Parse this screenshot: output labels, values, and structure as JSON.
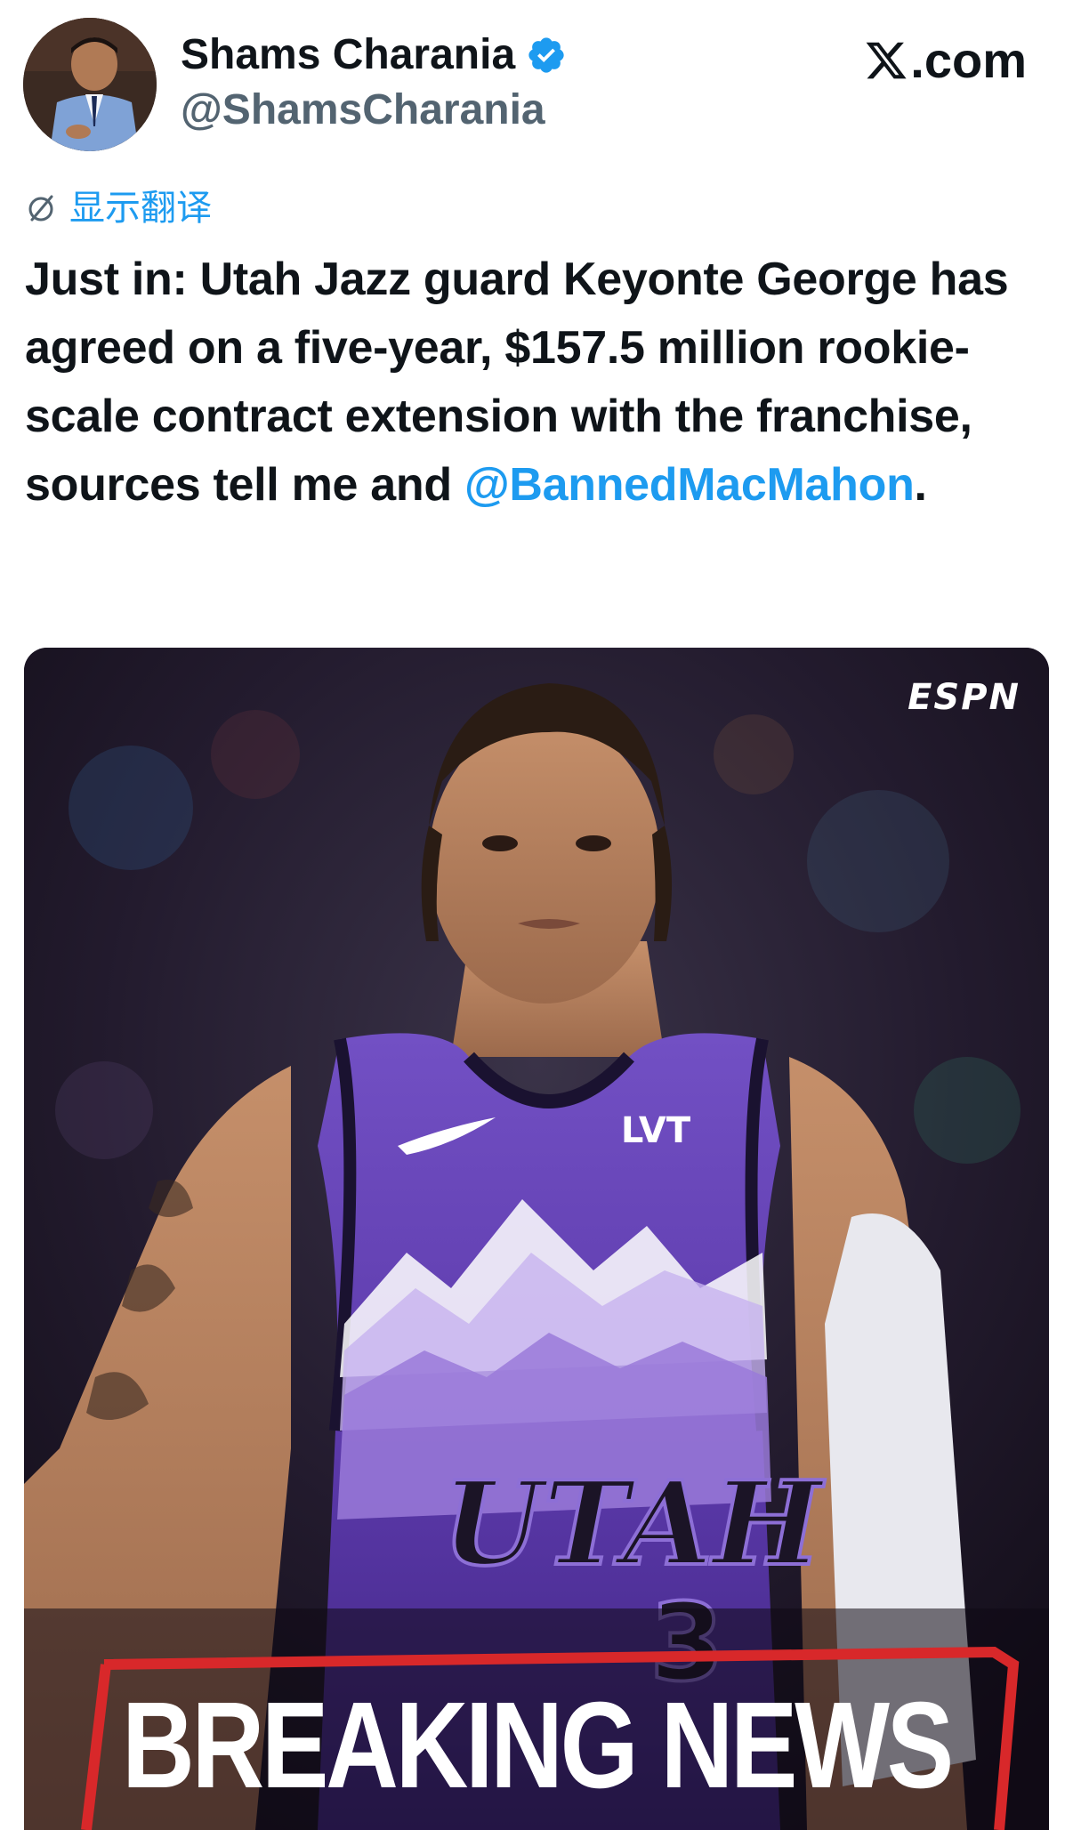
{
  "author": {
    "display_name": "Shams Charania",
    "handle": "@ShamsCharania",
    "verified": true
  },
  "brand": {
    "label": ".com",
    "icon": "x-logo-icon"
  },
  "translate": {
    "label": "显示翻译",
    "icon": "translate-icon"
  },
  "tweet": {
    "text": "Just in: Utah Jazz guard Keyonte George has agreed on a five-year, $157.5 million rookie-scale contract extension with the franchise, sources tell me and ",
    "mention": "@BannedMacMahon",
    "trailing": "."
  },
  "media": {
    "watermark": "ESPN",
    "jersey_team": "UTAH",
    "jersey_number": "3",
    "jersey_sponsor": "LVT",
    "banner": "BREAKING NEWS"
  },
  "colors": {
    "link": "#1d9bf0",
    "secondary_text": "#536471",
    "primary_text": "#0f1419",
    "jersey_purple": "#5b3aa6",
    "banner_red": "#d8282a"
  }
}
